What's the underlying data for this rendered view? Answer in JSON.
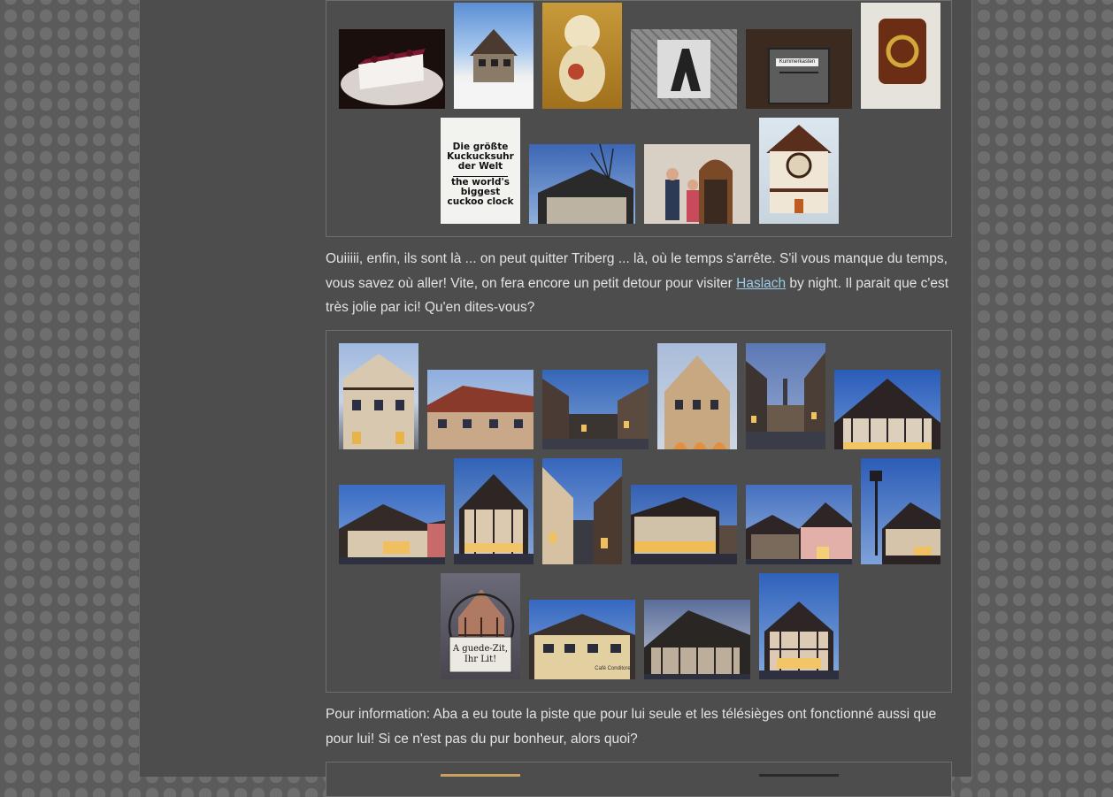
{
  "gallery1": {
    "sign": {
      "de": "Die größte Kuckucksuhr der Welt",
      "en": "the world's biggest cuckoo clock"
    },
    "mailbox_label": "Kummerkasten"
  },
  "paragraph1": {
    "before": "Ouiiiii, enfin, ils sont là ... on peut quitter Triberg ... là, où le temps s'arrête. S'il vous manque du temps, vous savez où aller! Vite, on fera encore un petit detour pour visiter ",
    "link": "Haslach",
    "after": " by night. Il parait que c'est très jolie par ici! Qu'en dites-vous?"
  },
  "gallery2": {
    "sign_text": "A guede-Zit, Ihr Lit!",
    "shop_text": "Café Conditorei"
  },
  "paragraph2": {
    "text": "Pour information: Aba a eu toute la piste que pour lui seule et les télésièges ont fonctionné aussi que pour lui! Si ce n'est pas du pur bonheur, alors quoi?"
  },
  "colors": {
    "link": "#9ccbe6",
    "text": "#e3e3e3",
    "column_bg": "#4d4d4d"
  }
}
